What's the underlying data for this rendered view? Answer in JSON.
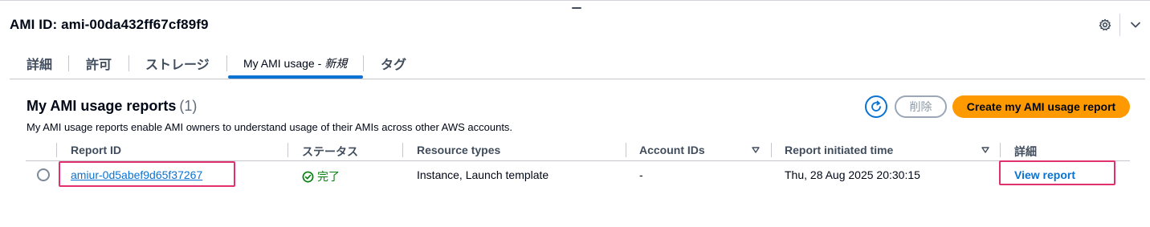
{
  "header": {
    "title": "AMI ID: ami-00da432ff67cf89f9"
  },
  "tabs": [
    {
      "label": "詳細"
    },
    {
      "label": "許可"
    },
    {
      "label": "ストレージ"
    },
    {
      "label": "My AMI usage -",
      "badge": "新規"
    },
    {
      "label": "タグ"
    }
  ],
  "section": {
    "title": "My AMI usage reports",
    "count": "(1)",
    "description": "My AMI usage reports enable AMI owners to understand usage of their AMIs across other AWS accounts."
  },
  "actions": {
    "delete_label": "削除",
    "create_label": "Create my AMI usage report"
  },
  "table": {
    "columns": [
      "Report ID",
      "ステータス",
      "Resource types",
      "Account IDs",
      "Report initiated time",
      "詳細"
    ],
    "rows": [
      {
        "report_id": "amiur-0d5abef9d65f37267",
        "status": "完了",
        "resource_types": "Instance, Launch template",
        "account_ids": "-",
        "initiated_time": "Thu, 28 Aug 2025 20:30:15",
        "details": "View report"
      }
    ]
  },
  "colors": {
    "primary": "#0972d3",
    "accent": "#ff9900",
    "success": "#037f0c",
    "highlight": "#e0306e"
  }
}
